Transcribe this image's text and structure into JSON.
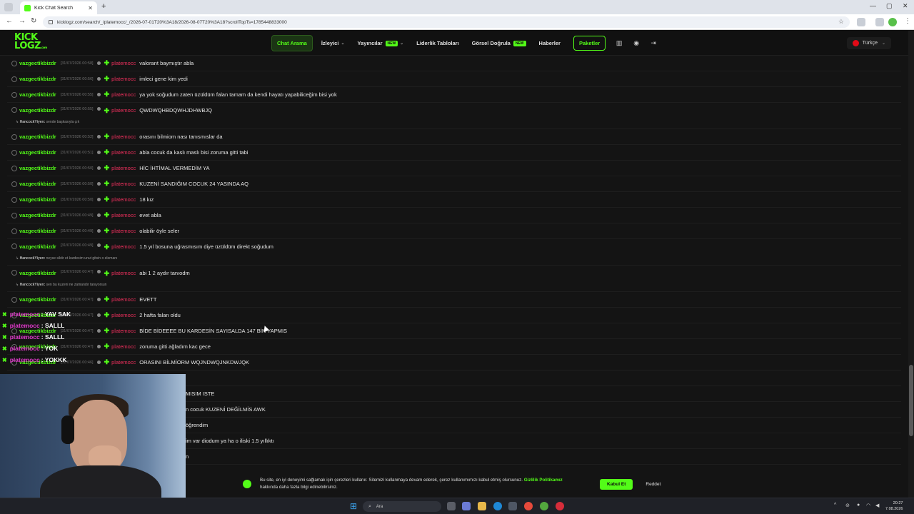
{
  "browser": {
    "tab_title": "Kick Chat Search",
    "url": "kicklogz.com/search/_/platemocc/_/2026-07-01T20%3A18/2026-08-07T20%3A18?scrollTopTs=1785448833000"
  },
  "site": {
    "logo_line1": "KICK",
    "logo_line2": "LOGZ",
    "logo_suffix": ".com",
    "nav": {
      "chat_search": "Chat Arama",
      "viewer": "İzleyici",
      "streamers": "Yayıncılar",
      "leaderboards": "Liderlik Tabloları",
      "visual_verify": "Görsel Doğrula",
      "news": "Haberler",
      "packages": "Paketler",
      "new_badge": "NEW"
    },
    "language": "Türkçe"
  },
  "chat": {
    "rows": [
      {
        "user": "vazgectikbizdr",
        "ts": "[31/07/2026 00:58]",
        "target": "platemocc",
        "text": "valorant baymıştır abla"
      },
      {
        "user": "vazgectikbizdr",
        "ts": "[31/07/2026 00:56]",
        "target": "platemocc",
        "text": "imleci gene kim yedi"
      },
      {
        "user": "vazgectikbizdr",
        "ts": "[31/07/2026 00:55]",
        "target": "platemocc",
        "text": "ya yok soğudum zaten üzüldüm falan tamam da kendi hayatı yapabiliceğim bisi yok"
      },
      {
        "user": "vazgectikbizdr",
        "ts": "[31/07/2026 00:55]",
        "target": "platemocc",
        "text": "QWDWQHBDQWHJDHWBJQ",
        "reply_user": "HancockYiyen:",
        "reply_text": "sende başkasıyla çık"
      },
      {
        "user": "vazgectikbizdr",
        "ts": "[31/07/2026 00:52]",
        "target": "platemocc",
        "text": "orasını bilmiom nası tanısmıslar da"
      },
      {
        "user": "vazgectikbizdr",
        "ts": "[31/07/2026 00:51]",
        "target": "platemocc",
        "text": "abla cocuk da kaslı maslı bisi zoruma gitti tabi"
      },
      {
        "user": "vazgectikbizdr",
        "ts": "[31/07/2026 00:50]",
        "target": "platemocc",
        "text": "HİC İHTİMAL VERMEDİM YA"
      },
      {
        "user": "vazgectikbizdr",
        "ts": "[31/07/2026 00:50]",
        "target": "platemocc",
        "text": "KUZENİ SANDIĞIM COCUK 24 YASINDA AQ"
      },
      {
        "user": "vazgectikbizdr",
        "ts": "[31/07/2026 00:50]",
        "target": "platemocc",
        "text": "18 kız"
      },
      {
        "user": "vazgectikbizdr",
        "ts": "[31/07/2026 00:49]",
        "target": "platemocc",
        "text": "evet abla"
      },
      {
        "user": "vazgectikbizdr",
        "ts": "[31/07/2026 00:49]",
        "target": "platemocc",
        "text": "olabilir öyle seler"
      },
      {
        "user": "vazgectikbizdr",
        "ts": "[31/07/2026 00:49]",
        "target": "platemocc",
        "text": "1.5 yıl bosuna uğrasmısım diye üzüldüm direkt soğudum",
        "reply_user": "HancockYiyen:",
        "reply_text": "neyse siktir et kardesim unut gitsin o elemanı"
      },
      {
        "user": "vazgectikbizdr",
        "ts": "[31/07/2026 00:47]",
        "target": "platemocc",
        "text": "abi 1 2 aydır tanıodm",
        "reply_user": "HancockYiyen:",
        "reply_text": "sen bu kuzeni ne zamandır tanıyorsun"
      },
      {
        "user": "vazgectikbizdr",
        "ts": "[31/07/2026 00:47]",
        "target": "platemocc",
        "text": "EVETT"
      },
      {
        "user": "vazgectikbizdr",
        "ts": "[31/07/2026 00:47]",
        "target": "platemocc",
        "text": "2 hafta falan oldu"
      },
      {
        "user": "vazgectikbizdr",
        "ts": "[31/07/2026 00:47]",
        "target": "platemocc",
        "text": "BİDE BİDEEEE BU KARDESİN SAYISALDA 147 BİN YAPMIS"
      },
      {
        "user": "vazgectikbizdr",
        "ts": "[31/07/2026 00:47]",
        "target": "platemocc",
        "text": "zoruma gitti ağladım kac gece"
      },
      {
        "user": "vazgectikbizdr",
        "ts": "[31/07/2026 00:46]",
        "target": "platemocc",
        "text": "ORASINI BİLMİORM WQJNDWQJNKDWJQK"
      },
      {
        "user": "",
        "ts": "",
        "target": "",
        "text": ""
      },
      {
        "user": "",
        "ts": "",
        "target": "",
        "text": "MISIM ISTE"
      },
      {
        "user": "",
        "ts": "",
        "target": "",
        "text": "n cocuk KUZENİ DEĞİLMİS AWK"
      },
      {
        "user": "",
        "ts": "",
        "target": "",
        "text": "öğrendim"
      },
      {
        "user": "",
        "ts": "",
        "target": "",
        "text": "im var diodum ya ha o iliski 1.5 yıllıktı"
      },
      {
        "user": "",
        "ts": "",
        "target": "",
        "text": "n"
      }
    ]
  },
  "overlay": {
    "lines": [
      {
        "name": "platemocc",
        "text": ": YAV SAK"
      },
      {
        "name": "platemocc",
        "text": ": SALLL"
      },
      {
        "name": "platemocc",
        "text": ": SALLL"
      },
      {
        "name": "platemocc",
        "text": ": YOK"
      },
      {
        "name": "platemocc",
        "text": ": YOKKK"
      }
    ]
  },
  "cookie": {
    "text": "Bu site, en iyi deneyimi sağlamak için çerezleri kullanır. Sitemizi kullanmaya devam ederek, çerez kullanımımızı kabul etmiş olursunuz.",
    "link": "Gizlilik Politikamız",
    "text2": "hakkında daha fazla bilgi edinebilirsiniz.",
    "accept": "Kabul Et",
    "reject": "Reddet"
  },
  "taskbar": {
    "search_placeholder": "Ara",
    "time": "20:27",
    "date": "7.08.2026"
  },
  "colors": {
    "accent": "#53fc18",
    "target_name": "#ec2f5c",
    "overlay_name": "#e03acb"
  }
}
